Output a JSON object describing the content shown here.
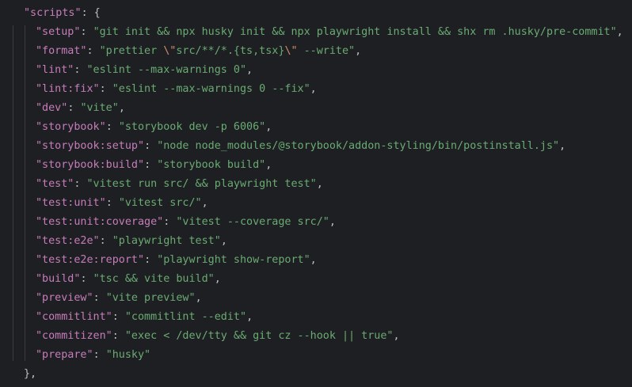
{
  "editor": {
    "object_key": "\"scripts\"",
    "open_brace": ": {",
    "close_brace": "},",
    "top_partial": "…",
    "lines": [
      {
        "key": "\"setup\"",
        "pre": "\"git init && npx husky init && npx playwright install && shx rm .husky/pre-commit\"",
        "esc1": "",
        "mid": "",
        "esc2": "",
        "post": "",
        "trail": ","
      },
      {
        "key": "\"format\"",
        "pre": "\"prettier ",
        "esc1": "\\\"",
        "mid": "src/**/*.{ts,tsx}",
        "esc2": "\\\"",
        "post": " --write\"",
        "trail": ","
      },
      {
        "key": "\"lint\"",
        "pre": "\"eslint --max-warnings 0\"",
        "esc1": "",
        "mid": "",
        "esc2": "",
        "post": "",
        "trail": ","
      },
      {
        "key": "\"lint:fix\"",
        "pre": "\"eslint --max-warnings 0 --fix\"",
        "esc1": "",
        "mid": "",
        "esc2": "",
        "post": "",
        "trail": ","
      },
      {
        "key": "\"dev\"",
        "pre": "\"vite\"",
        "esc1": "",
        "mid": "",
        "esc2": "",
        "post": "",
        "trail": ","
      },
      {
        "key": "\"storybook\"",
        "pre": "\"storybook dev -p 6006\"",
        "esc1": "",
        "mid": "",
        "esc2": "",
        "post": "",
        "trail": ","
      },
      {
        "key": "\"storybook:setup\"",
        "pre": "\"node node_modules/@storybook/addon-styling/bin/postinstall.js\"",
        "esc1": "",
        "mid": "",
        "esc2": "",
        "post": "",
        "trail": ","
      },
      {
        "key": "\"storybook:build\"",
        "pre": "\"storybook build\"",
        "esc1": "",
        "mid": "",
        "esc2": "",
        "post": "",
        "trail": ","
      },
      {
        "key": "\"test\"",
        "pre": "\"vitest run src/ && playwright test\"",
        "esc1": "",
        "mid": "",
        "esc2": "",
        "post": "",
        "trail": ","
      },
      {
        "key": "\"test:unit\"",
        "pre": "\"vitest src/\"",
        "esc1": "",
        "mid": "",
        "esc2": "",
        "post": "",
        "trail": ","
      },
      {
        "key": "\"test:unit:coverage\"",
        "pre": "\"vitest --coverage src/\"",
        "esc1": "",
        "mid": "",
        "esc2": "",
        "post": "",
        "trail": ","
      },
      {
        "key": "\"test:e2e\"",
        "pre": "\"playwright test\"",
        "esc1": "",
        "mid": "",
        "esc2": "",
        "post": "",
        "trail": ","
      },
      {
        "key": "\"test:e2e:report\"",
        "pre": "\"playwright show-report\"",
        "esc1": "",
        "mid": "",
        "esc2": "",
        "post": "",
        "trail": ","
      },
      {
        "key": "\"build\"",
        "pre": "\"tsc && vite build\"",
        "esc1": "",
        "mid": "",
        "esc2": "",
        "post": "",
        "trail": ","
      },
      {
        "key": "\"preview\"",
        "pre": "\"vite preview\"",
        "esc1": "",
        "mid": "",
        "esc2": "",
        "post": "",
        "trail": ","
      },
      {
        "key": "\"commitlint\"",
        "pre": "\"commitlint --edit\"",
        "esc1": "",
        "mid": "",
        "esc2": "",
        "post": "",
        "trail": ","
      },
      {
        "key": "\"commitizen\"",
        "pre": "\"exec < /dev/tty && git cz --hook || true\"",
        "esc1": "",
        "mid": "",
        "esc2": "",
        "post": "",
        "trail": ","
      },
      {
        "key": "\"prepare\"",
        "pre": "\"husky\"",
        "esc1": "",
        "mid": "",
        "esc2": "",
        "post": "",
        "trail": ""
      }
    ]
  },
  "colors": {
    "background": "#1e1f22",
    "key": "#c77dbb",
    "string": "#6aab73",
    "escape": "#cf8e6d",
    "punctuation": "#bcbec4"
  }
}
